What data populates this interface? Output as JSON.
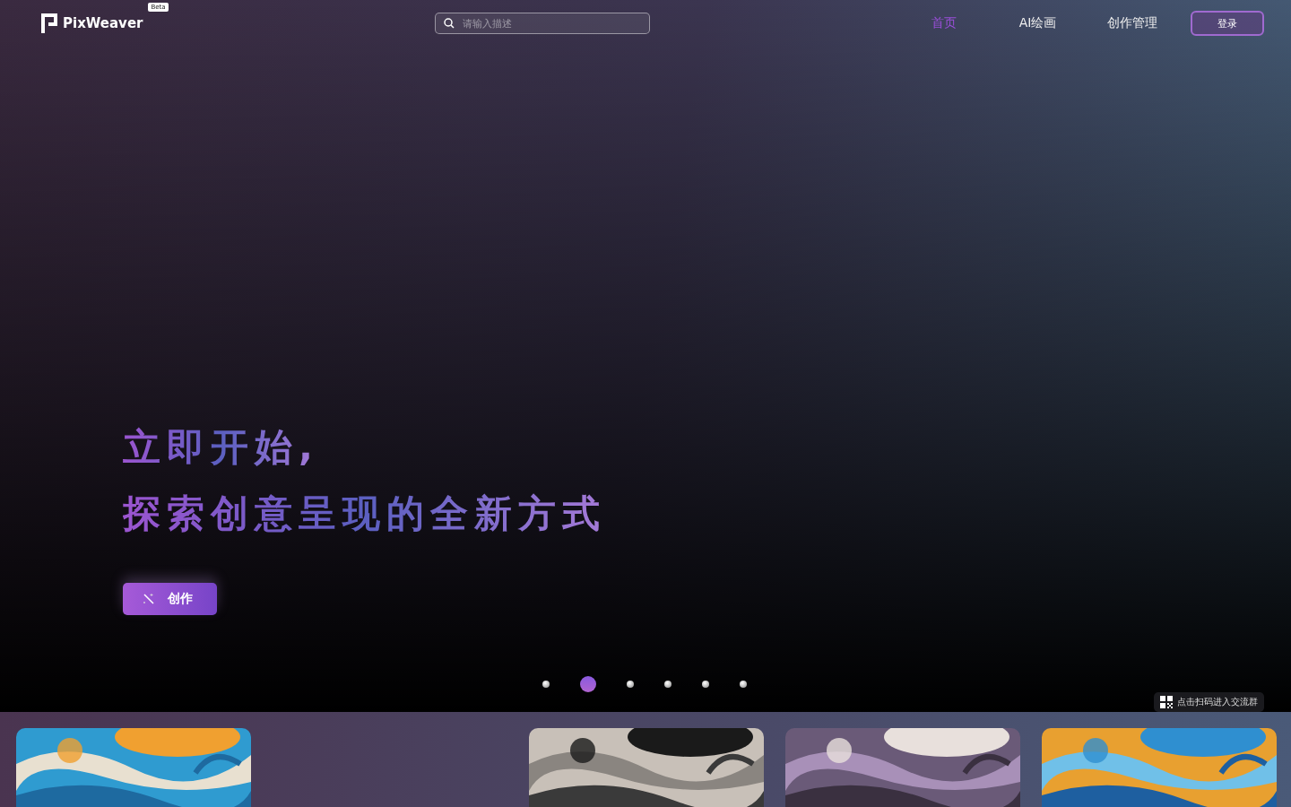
{
  "header": {
    "logo": "PixWeaver",
    "badge": "Beta",
    "search": {
      "placeholder": "请输入描述"
    },
    "nav": [
      {
        "label": "首页",
        "selected": true
      },
      {
        "label": "AI绘画",
        "selected": false
      },
      {
        "label": "创作管理",
        "selected": false
      }
    ],
    "login": "登录"
  },
  "hero": {
    "title_line_1": "立即开始,",
    "title_line_2": "探索创意呈现的全新方式",
    "button": "创作",
    "dots": [
      {
        "selected": false
      },
      {
        "selected": true
      },
      {
        "selected": false
      },
      {
        "selected": false
      },
      {
        "selected": false
      },
      {
        "selected": false
      }
    ],
    "community": "点击扫码进入交流群"
  }
}
